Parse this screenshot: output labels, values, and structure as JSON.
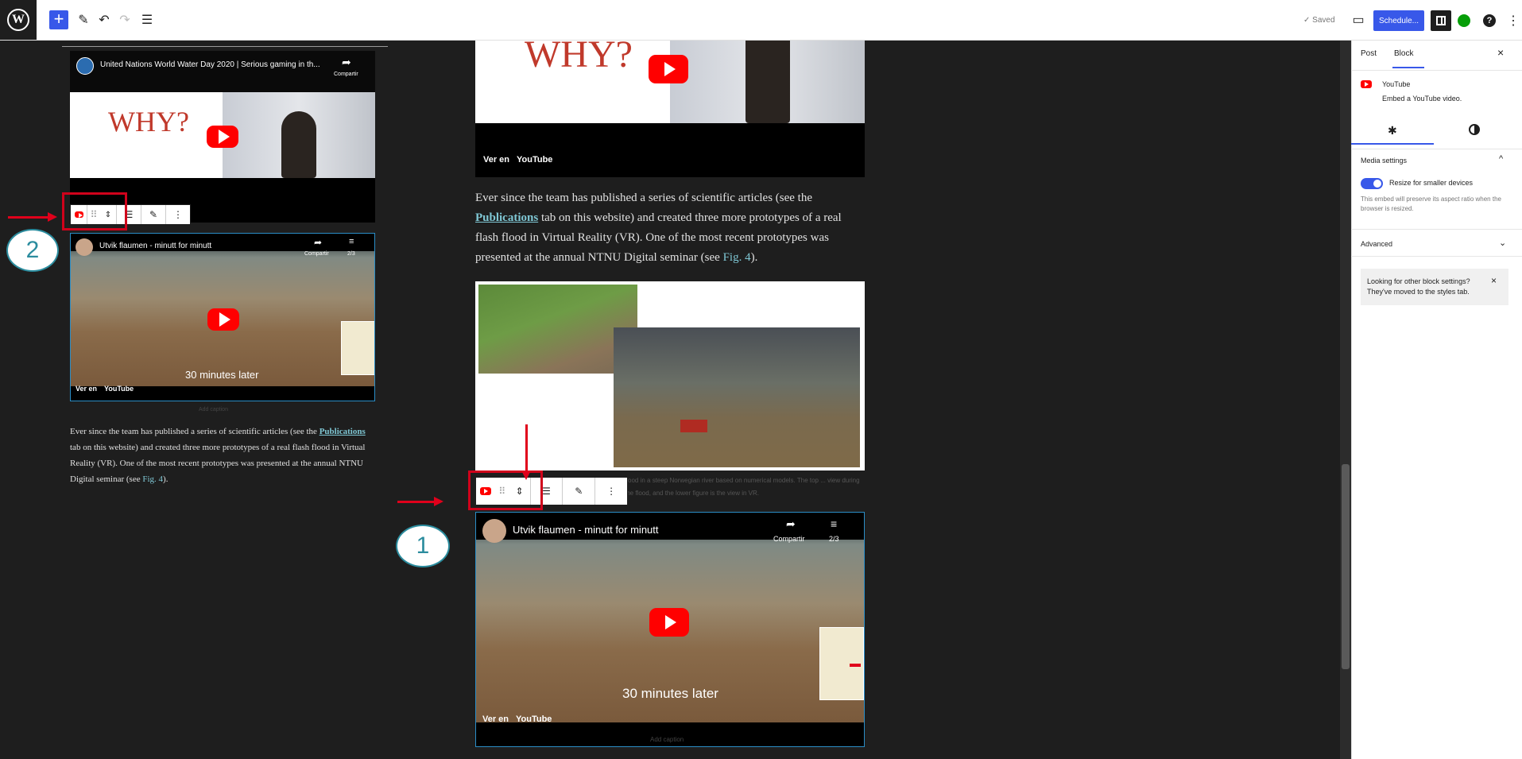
{
  "topbar": {
    "saved_label": "✓ Saved",
    "schedule_label": "Schedule...",
    "add_symbol": "+",
    "help_symbol": "?"
  },
  "sidebar": {
    "tabs": [
      "Post",
      "Block"
    ],
    "active_tab": "Block",
    "close_symbol": "×",
    "block_name": "YouTube",
    "block_desc": "Embed a YouTube video.",
    "media_settings_title": "Media settings",
    "toggle_label": "Resize for smaller devices",
    "toggle_on": true,
    "toggle_help": "This embed will preserve its aspect ratio when the browser is resized.",
    "advanced_title": "Advanced",
    "notice_text": "Looking for other block settings? They've moved to the styles tab."
  },
  "left_panel": {
    "video1_title": "United Nations World Water Day 2020 | Serious gaming in th...",
    "share_label": "Compartir",
    "why_text": "WHY?",
    "video2_title": "Utvik flaumen - minutt for minutt",
    "playlist_count": "2/3",
    "overlay_text": "30 minutes later",
    "watch_on": "Ver en",
    "youtube_label": "YouTube",
    "caption_placeholder": "Add caption",
    "paragraph": [
      "Ever since the team has published a series of scientific articles (see the ",
      "Publications",
      " tab on this website) and created three more prototypes of a real flash flood in Virtual Reality (VR). One of the most recent prototypes was presented at the annual NTNU Digital seminar (see ",
      "Fig. 4",
      ")."
    ]
  },
  "main_panel": {
    "why_text": "WHY?",
    "watch_on": "Ver en",
    "youtube_label": "YouTube",
    "paragraph": [
      "Ever since the team has published a series of scientific articles (see the ",
      "Publications",
      " tab on this website) and created three more prototypes of a real flash flood in Virtual Reality (VR). One of the most recent prototypes was presented at the annual NTNU Digital seminar (see ",
      "Fig. 4",
      ")."
    ],
    "figure_caption": "flood in a steep Norwegian river based on numerical models. The top ... view during the flood, and the lower figure is the view in VR.",
    "video2_title": "Utvik flaumen - minutt for minutt",
    "share_label": "Compartir",
    "playlist_count": "2/3",
    "overlay_text": "30 minutes later",
    "caption_placeholder": "Add caption"
  },
  "annotations": {
    "callout1": "1",
    "callout2": "2"
  },
  "colors": {
    "accent": "#3858e9",
    "annotation_red": "#d0021b",
    "callout_teal": "#2b8c9e",
    "youtube_red": "#ff0000"
  }
}
